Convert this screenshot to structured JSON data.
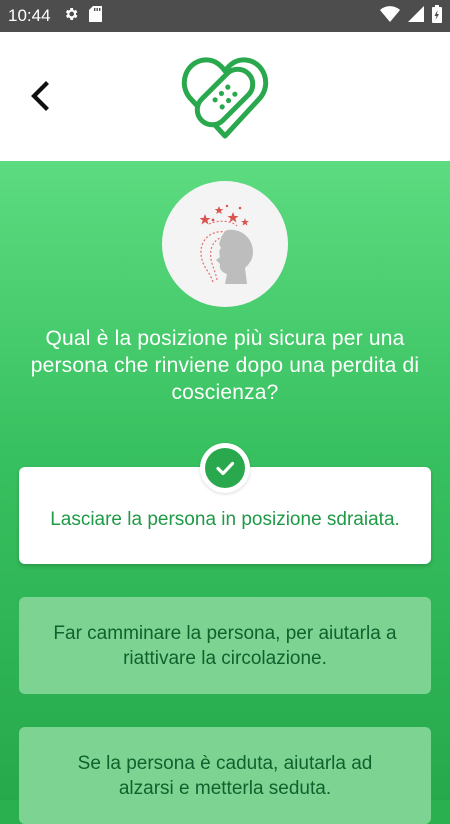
{
  "status_bar": {
    "time": "10:44",
    "icons": [
      "gear-icon",
      "sd-card-icon",
      "wifi-icon",
      "signal-icon",
      "battery-icon"
    ]
  },
  "header": {
    "back_icon": "chevron-left-icon",
    "logo_icon": "heart-bandage-logo"
  },
  "question": {
    "illustration_icon": "dizzy-head-icon",
    "text": "Qual è la posizione più sicura per una persona che rinviene dopo una  perdita di coscienza?"
  },
  "answers": [
    {
      "text": "Lasciare la persona  in posizione sdraiata.",
      "selected": true
    },
    {
      "text": "Far camminare la persona, per aiutarla a riattivare la circolazione.",
      "selected": false
    },
    {
      "text": "Se la persona è caduta, aiutarla ad alzarsi e metterla seduta.",
      "selected": false
    }
  ],
  "colors": {
    "accent_green": "#2aa84d",
    "gradient_top": "#5ddb80",
    "gradient_bottom": "#26a94b",
    "option_bg": "#7dd492",
    "status_bar": "#4d4d4d"
  }
}
